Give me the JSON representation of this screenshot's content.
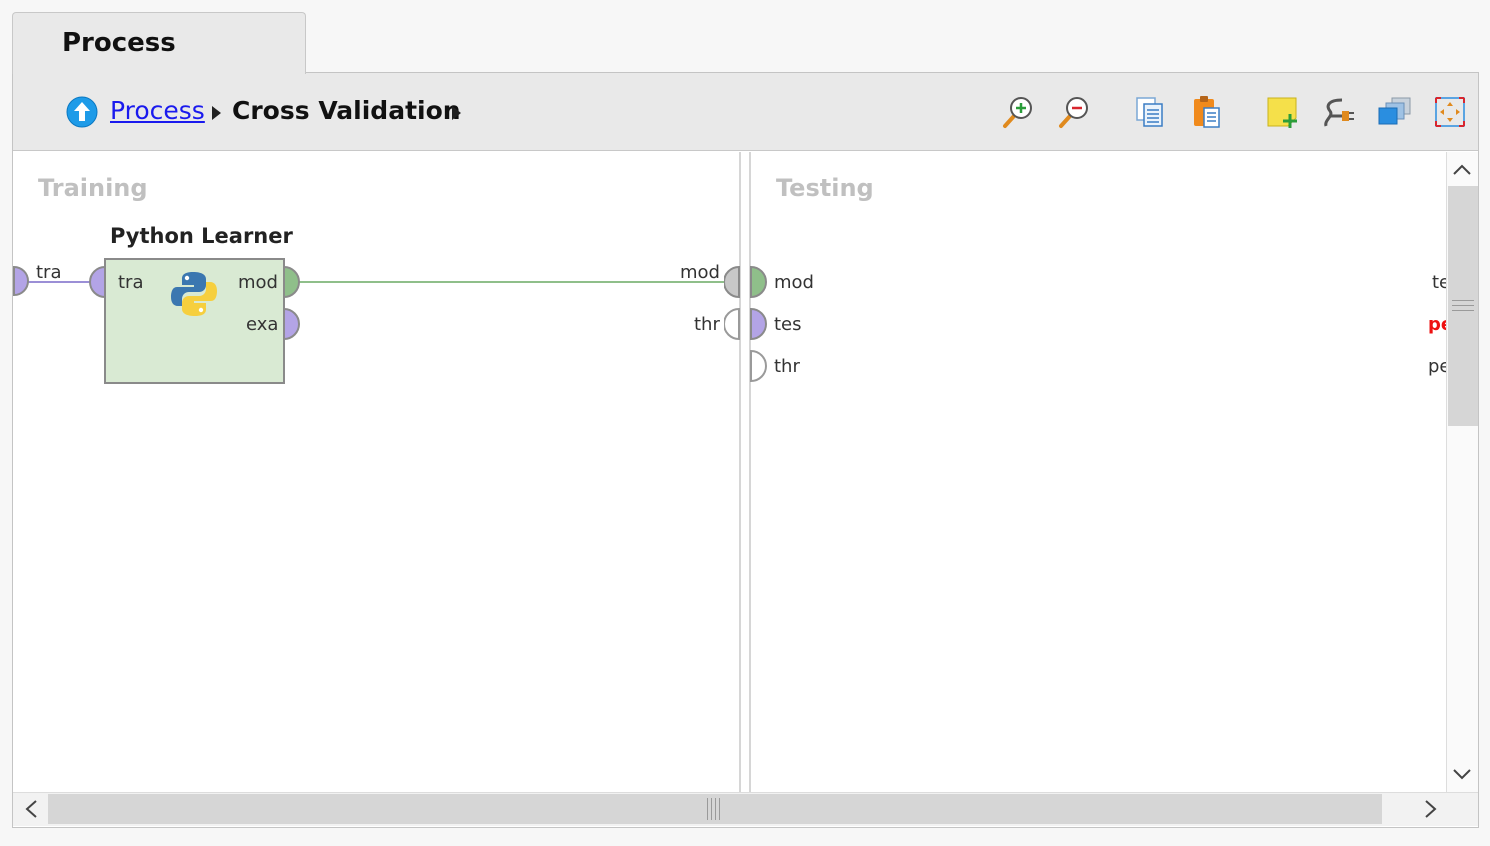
{
  "tab": {
    "label": "Process"
  },
  "breadcrumb": {
    "root": "Process",
    "current": "Cross Validation"
  },
  "toolbar": {
    "icons": [
      "zoom-in-icon",
      "zoom-out-icon",
      "copy-icon",
      "paste-icon",
      "add-note-icon",
      "auto-wire-icon",
      "arrange-operators-icon",
      "fit-view-icon"
    ]
  },
  "training": {
    "title": "Training",
    "input_port": "tra",
    "output_ports": [
      "mod",
      "thr"
    ]
  },
  "operator": {
    "name": "Python Learner",
    "input_port": "tra",
    "output_ports": [
      "mod",
      "exa"
    ]
  },
  "testing": {
    "title": "Testing",
    "input_ports": [
      "mod",
      "tes",
      "thr"
    ],
    "output_ports": [
      "te",
      "pe",
      "pe"
    ]
  },
  "colors": {
    "model_port": "#8fbf8a",
    "example_port": "#b3a4e6",
    "operator_fill": "#d9ead3",
    "link": "#1a1aee",
    "error_port_label": "#ee1111"
  }
}
